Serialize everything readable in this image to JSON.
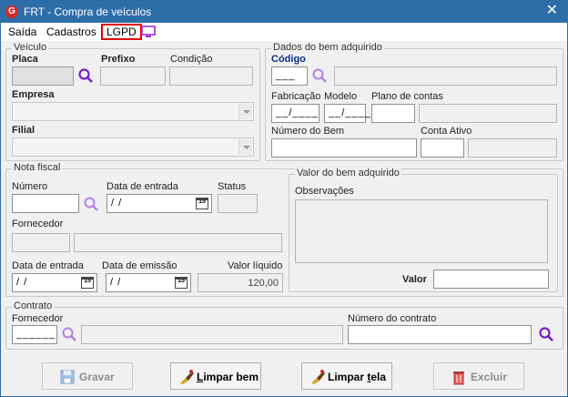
{
  "window": {
    "title": "FRT - Compra de veículos",
    "close": "✕",
    "app_icon": "G"
  },
  "menu": {
    "items": [
      "Saída",
      "Cadastros"
    ],
    "lgpd": "LGPD",
    "monitor_icon": "monitor-icon"
  },
  "veiculo": {
    "legend": "Veículo",
    "placa_label": "Placa",
    "prefixo_label": "Prefixo",
    "condicao_label": "Condição",
    "empresa_label": "Empresa",
    "filial_label": "Filial"
  },
  "bem": {
    "legend": "Dados do bem adquirido",
    "codigo_label": "Código",
    "codigo_value": "___",
    "fabricacao_label": "Fabricação",
    "modelo_label": "Modelo",
    "plano_label": "Plano de contas",
    "fabricacao_value": "__/____",
    "modelo_value": "__/____",
    "numero_bem_label": "Número do Bem",
    "conta_ativo_label": "Conta Ativo"
  },
  "nota": {
    "legend": "Nota fiscal",
    "numero_label": "Número",
    "data_entrada_label": "Data de entrada",
    "status_label": "Status",
    "data_entrada_value": " /  /",
    "fornecedor_label": "Fornecedor",
    "data_entrada2_label": "Data de entrada",
    "data_emissao_label": "Data de emissão",
    "valor_liquido_label": "Valor líquido",
    "data_entrada2_value": " /  /",
    "data_emissao_value": " /  /",
    "valor_liquido_value": "120,00",
    "cal_glyph": "15"
  },
  "valor_bem": {
    "legend": "Valor do bem adquirido",
    "observacoes_label": "Observações",
    "valor_label": "Valor"
  },
  "contrato": {
    "legend": "Contrato",
    "fornecedor_label": "Fornecedor",
    "fornecedor_value": "______",
    "numero_label": "Número do contrato"
  },
  "buttons": {
    "gravar": "Gravar",
    "limpar_bem_u": "L",
    "limpar_bem_rest": "impar bem",
    "limpar_tela_pre": "Limpar ",
    "limpar_tela_u": "t",
    "limpar_tela_rest": "ela",
    "excluir": "Excluir"
  },
  "colors": {
    "titlebar": "#2e6ea8",
    "search_icon": "#8a2be2",
    "lgpd_border": "#e00000",
    "code_label": "#0b2b8a"
  }
}
